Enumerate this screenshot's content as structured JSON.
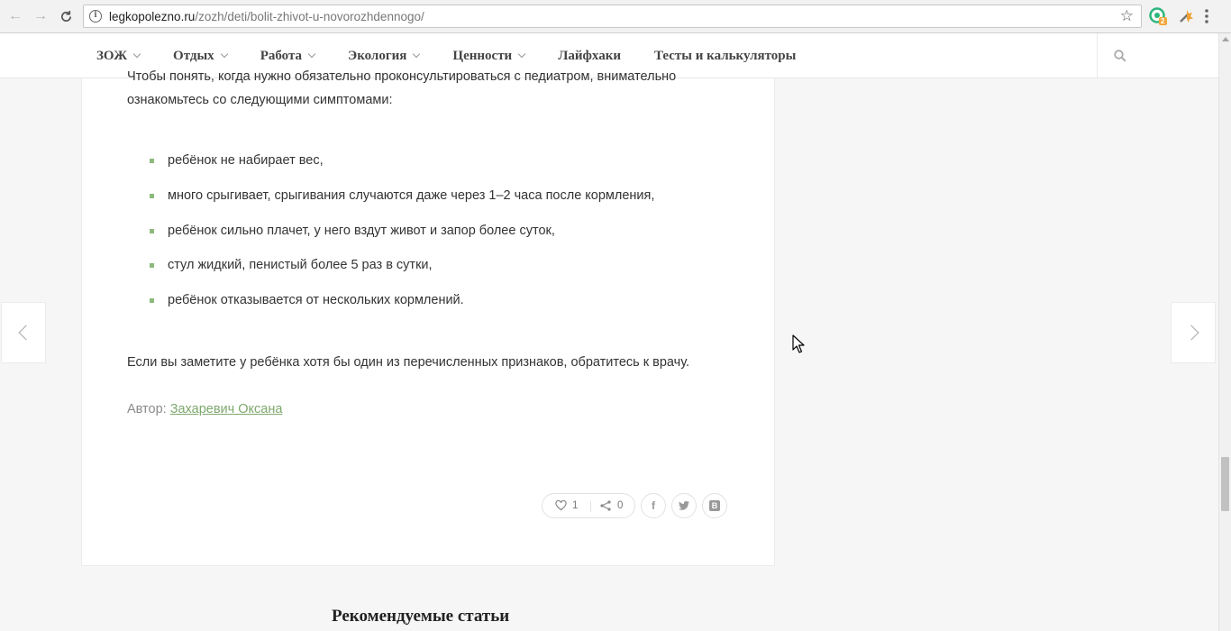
{
  "browser": {
    "url_host": "legkopolezno.ru",
    "url_path": "/zozh/deti/bolit-zhivot-u-novorozhdennogo/",
    "extension_badge": "2"
  },
  "nav": {
    "items": [
      {
        "label": "ЗОЖ",
        "has_dropdown": true
      },
      {
        "label": "Отдых",
        "has_dropdown": true
      },
      {
        "label": "Работа",
        "has_dropdown": true
      },
      {
        "label": "Экология",
        "has_dropdown": true
      },
      {
        "label": "Ценности",
        "has_dropdown": true
      },
      {
        "label": "Лайфхаки",
        "has_dropdown": false
      },
      {
        "label": "Тесты и калькуляторы",
        "has_dropdown": false
      }
    ]
  },
  "article": {
    "intro": "Чтобы понять, когда нужно обязательно проконсультироваться с педиатром, внимательно ознакомьтесь со следующими симптомами:",
    "symptoms": [
      "ребёнок не набирает вес,",
      "много срыгивает, срыгивания случаются даже через 1–2 часа после кормления,",
      "ребёнок сильно плачет, у него вздут живот и запор более суток,",
      "стул жидкий, пенистый более 5 раз в сутки,",
      "ребёнок отказывается от нескольких кормлений."
    ],
    "conclusion": "Если вы заметите у ребёнка хотя бы один из перечисленных признаков, обратитесь к врачу.",
    "author_label": "Автор:",
    "author_name": "Захаревич Оксана"
  },
  "social": {
    "likes": "1",
    "shares": "0",
    "vk_letter": "В"
  },
  "recommended": {
    "title": "Рекомендуемые статьи"
  },
  "colors": {
    "accent_green": "#8cba7c",
    "link_green": "#7da86c"
  }
}
